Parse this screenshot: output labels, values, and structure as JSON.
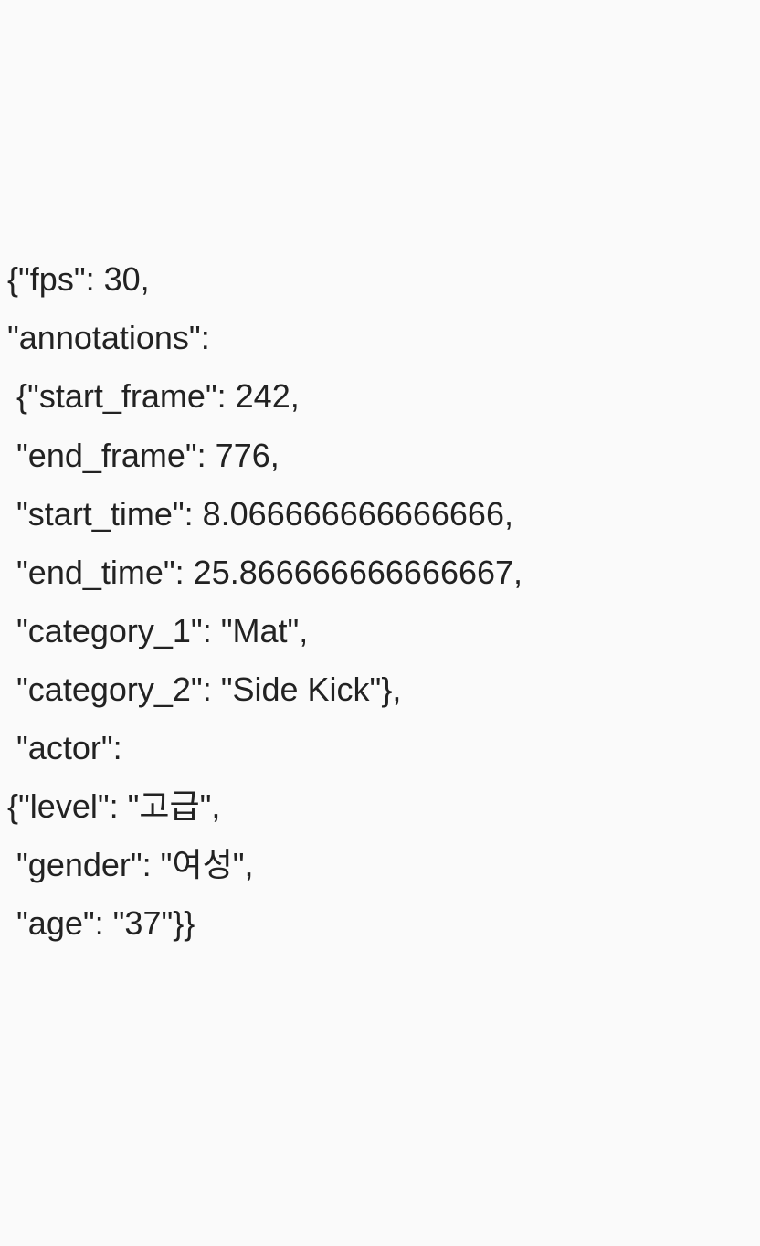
{
  "code": {
    "line1": "{\"fps\": 30,",
    "line2": "\"annotations\":",
    "line3": " {\"start_frame\": 242,",
    "line4": " \"end_frame\": 776,",
    "line5": " \"start_time\": 8.066666666666666,",
    "line6": " \"end_time\": 25.866666666666667,",
    "line7": " \"category_1\": \"Mat\",",
    "line8": " \"category_2\": \"Side Kick\"},",
    "line9": " \"actor\":",
    "line10": "{\"level\": \"고급\",",
    "line11": " \"gender\": \"여성\",",
    "line12": " \"age\": \"37\"}}"
  }
}
